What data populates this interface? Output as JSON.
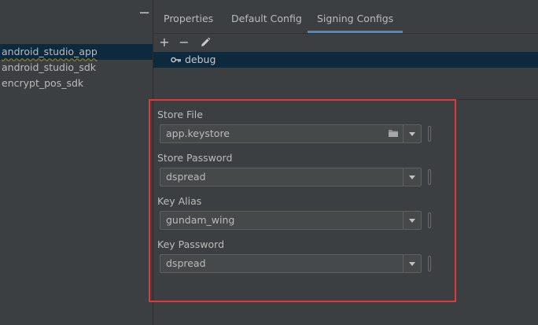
{
  "modules": {
    "collapse_label": "−",
    "items": [
      {
        "label": "android_studio_app",
        "selected": true
      },
      {
        "label": "android_studio_sdk",
        "selected": false
      },
      {
        "label": "encrypt_pos_sdk",
        "selected": false
      }
    ]
  },
  "tabs": [
    {
      "label": "Properties",
      "active": false
    },
    {
      "label": "Default Config",
      "active": false
    },
    {
      "label": "Signing Configs",
      "active": true
    }
  ],
  "toolbar": {
    "add_label": "+",
    "remove_label": "−",
    "edit_icon": "pencil-icon"
  },
  "configs": [
    {
      "name": "debug",
      "icon": "key-icon"
    }
  ],
  "form": {
    "store_file": {
      "label": "Store File",
      "value": "app.keystore",
      "icon": "folder-icon"
    },
    "store_password": {
      "label": "Store Password",
      "value": "dspread"
    },
    "key_alias": {
      "label": "Key Alias",
      "value": "gundam_wing"
    },
    "key_password": {
      "label": "Key Password",
      "value": "dspread"
    }
  },
  "colors": {
    "selection": "#0d293e",
    "active_tab_underline": "#4a88c7",
    "highlight_border": "#e0393b"
  }
}
